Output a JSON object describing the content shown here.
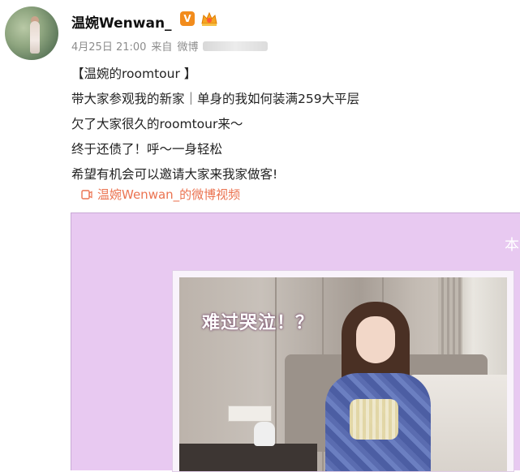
{
  "author": {
    "name": "温婉Wenwan_",
    "verified_badge": "V",
    "avatar_icon": "user-avatar",
    "level_icon": "crown-badge-icon"
  },
  "post": {
    "date": "4月25日 21:00",
    "source_prefix": "来自",
    "source": "微博",
    "lines": [
      "【温婉的roomtour 】",
      "带大家参观我的新家｜单身的我如何装满259大平层",
      "欠了大家很久的roomtour来～",
      "终于还债了！呼～一身轻松",
      "希望有机会可以邀请大家来我家做客!"
    ],
    "video_link": "温婉Wenwan_的微博视频"
  },
  "video": {
    "corner_text": "本",
    "caption": "难过哭泣！？",
    "background": "#e8c9f1"
  },
  "colors": {
    "link": "#eb7350",
    "meta": "#8c8c8c",
    "badge": "#f28c1d"
  }
}
